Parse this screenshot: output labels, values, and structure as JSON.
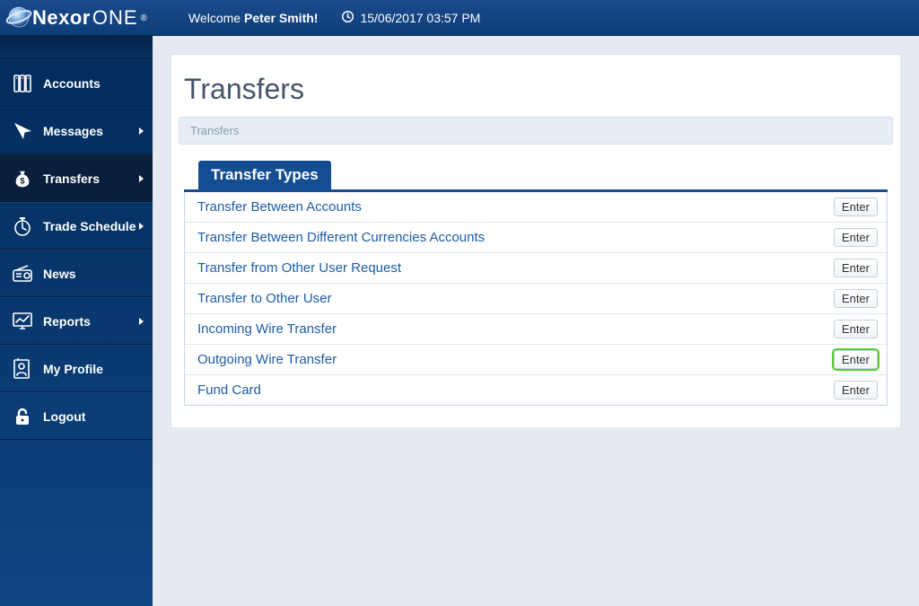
{
  "header": {
    "brand_main": "Nexor",
    "brand_suffix": "ONE",
    "brand_registered": "®",
    "welcome_prefix": "Welcome ",
    "welcome_name": "Peter Smith!",
    "datetime": "15/06/2017 03:57 PM"
  },
  "sidebar": {
    "items": [
      {
        "id": "accounts",
        "label": "Accounts",
        "icon": "servers-icon",
        "has_sub": false
      },
      {
        "id": "messages",
        "label": "Messages",
        "icon": "cursor-icon",
        "has_sub": true
      },
      {
        "id": "transfers",
        "label": "Transfers",
        "icon": "moneybag-icon",
        "has_sub": true,
        "active": true
      },
      {
        "id": "trade-schedule",
        "label": "Trade Schedule",
        "icon": "stopwatch-icon",
        "has_sub": true
      },
      {
        "id": "news",
        "label": "News",
        "icon": "radio-icon",
        "has_sub": false
      },
      {
        "id": "reports",
        "label": "Reports",
        "icon": "chart-icon",
        "has_sub": true
      },
      {
        "id": "my-profile",
        "label": "My Profile",
        "icon": "profile-icon",
        "has_sub": false
      },
      {
        "id": "logout",
        "label": "Logout",
        "icon": "lock-icon",
        "has_sub": false
      }
    ]
  },
  "page": {
    "title": "Transfers",
    "breadcrumb": "Transfers",
    "tab_label": "Transfer Types",
    "enter_label": "Enter",
    "rows": [
      {
        "label": "Transfer Between Accounts"
      },
      {
        "label": "Transfer Between Different Currencies Accounts"
      },
      {
        "label": "Transfer from Other User Request"
      },
      {
        "label": "Transfer to Other User"
      },
      {
        "label": "Incoming Wire Transfer"
      },
      {
        "label": "Outgoing Wire Transfer",
        "highlight": true
      },
      {
        "label": "Fund Card"
      }
    ]
  }
}
